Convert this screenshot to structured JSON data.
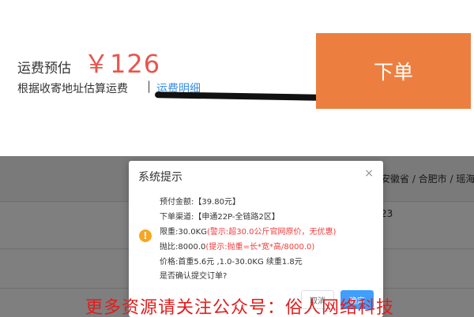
{
  "estimate": {
    "label": "运费预估",
    "amount": "￥126",
    "note": "根据收寄地址估算运费",
    "separator": "|",
    "detail_link": "运费明细"
  },
  "order_button": "下单",
  "background_table": {
    "row1_text": "安徽省 / 合肥市 / 瑶海区",
    "row2_text": "23"
  },
  "dialog": {
    "title": "系统提示",
    "close_icon": "×",
    "warn_icon": "!",
    "lines": {
      "prepay": "预付金额:【39.80元】",
      "channel": "下单渠道:【申通22P-全链路2区】",
      "weight_limit": "限重:30.0KG",
      "weight_warning": "(警示:超30.0公斤官网原价，无优惠)",
      "ratio": "抛比:8000.0",
      "ratio_hint": "(提示:抛重=长*宽*高/8000.0)",
      "price": "价格:首重5.6元 ,1.0-30.0KG 续重1.8元",
      "confirm_question": "是否确认提交订单?"
    },
    "cancel_label": "取消",
    "confirm_label": "确定"
  },
  "watermark": "更多资源请关注公众号：俗人网络科技",
  "colors": {
    "accent_orange": "#ec7f3f",
    "price_red": "#e8554e",
    "link_blue": "#3a8ee6",
    "confirm_blue": "#409eff",
    "warning_yellow": "#f5a623"
  }
}
